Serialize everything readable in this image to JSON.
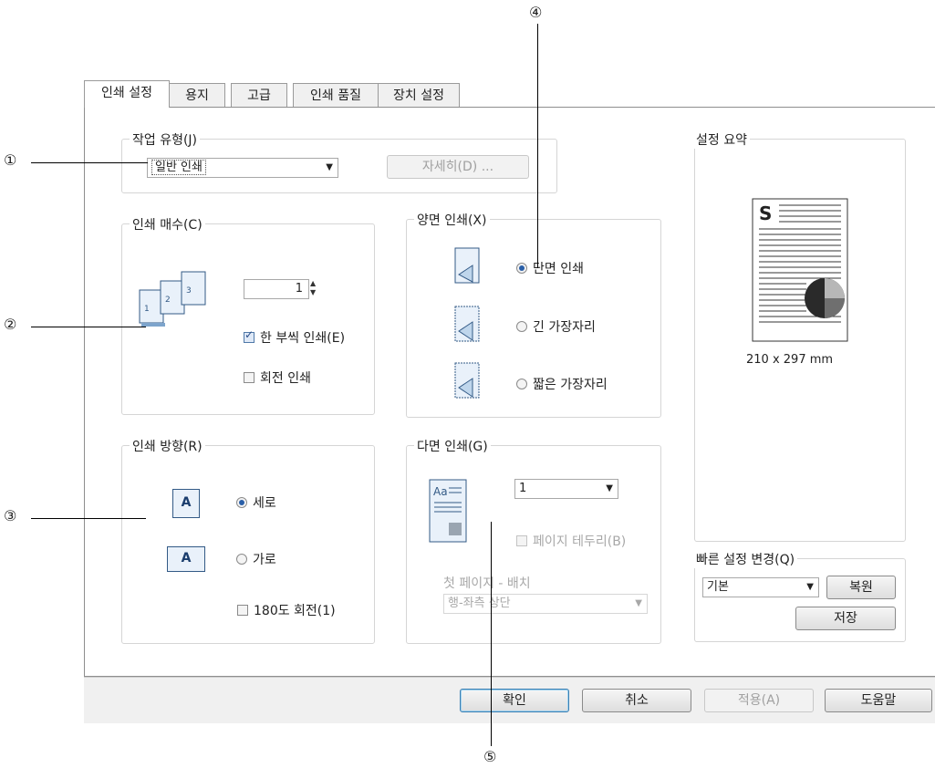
{
  "tabs": [
    "인쇄 설정",
    "용지",
    "고급",
    "인쇄 품질",
    "장치 설정"
  ],
  "job_type": {
    "legend": "작업 유형(J)",
    "value": "일반 인쇄",
    "details_button": "자세히(D) ..."
  },
  "copies": {
    "legend": "인쇄 매수(C)",
    "value": "1",
    "collate_label": "한 부씩 인쇄(E)",
    "rotate_label": "회전 인쇄",
    "page_icon_numbers": [
      "1",
      "2",
      "3"
    ]
  },
  "duplex": {
    "legend": "양면 인쇄(X)",
    "options": [
      "단면 인쇄",
      "긴 가장자리",
      "짧은 가장자리"
    ],
    "selected": 0
  },
  "orientation": {
    "legend": "인쇄 방향(R)",
    "options": [
      "세로",
      "가로"
    ],
    "selected": 0,
    "rotate180_label": "180도 회전(1)",
    "icon_letter": "A"
  },
  "nup": {
    "legend": "다면 인쇄(G)",
    "value": "1",
    "border_label": "페이지 테두리(B)",
    "first_page_label": "첫 페이지 - 배치",
    "layout_value": "행-좌측 상단",
    "icon_text": "Aa"
  },
  "summary": {
    "legend": "설정 요약",
    "letter": "S",
    "size_text": "210 x 297 mm"
  },
  "quick": {
    "legend": "빠른 설정 변경(Q)",
    "value": "기본",
    "restore_button": "복원",
    "save_button": "저장"
  },
  "footer": {
    "ok": "확인",
    "cancel": "취소",
    "apply": "적용(A)",
    "help": "도움말"
  },
  "callouts": [
    "①",
    "②",
    "③",
    "④",
    "⑤"
  ]
}
